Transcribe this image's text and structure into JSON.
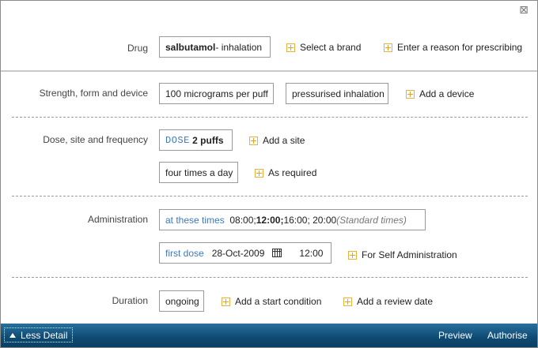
{
  "close_icon_glyph": "⊠",
  "drug": {
    "label": "Drug",
    "name": "salbutamol",
    "route": " - inhalation",
    "brand_action": "Select a brand",
    "reason_action": "Enter a reason for prescribing"
  },
  "strength": {
    "label": "Strength, form and device",
    "strength_value": "100 micrograms per puff",
    "form_value": "pressurised inhalation",
    "device_action": "Add a device"
  },
  "dose": {
    "label": "Dose, site and frequency",
    "dose_keyword": "DOSE",
    "dose_value": "2 puffs",
    "site_action": "Add a site",
    "frequency_value": "four times a day",
    "as_required_action": "As required"
  },
  "administration": {
    "label": "Administration",
    "times_keyword": "at these times",
    "time1": "08:00; ",
    "time2": "12:00;",
    "time3": " 16:00; 20:00 ",
    "times_note": "(Standard times)",
    "first_dose_keyword": "first dose",
    "first_dose_date": "28-Oct-2009",
    "first_dose_time": "12:00",
    "self_admin_action": "For Self Administration"
  },
  "duration": {
    "label": "Duration",
    "value": "ongoing",
    "start_action": "Add a start condition",
    "review_action": "Add a review date"
  },
  "footer": {
    "less_detail": "Less Detail",
    "preview": "Preview",
    "authorise": "Authorise"
  },
  "colors": {
    "accent_blue": "#3d78b8",
    "plus_orange": "#e8a21c",
    "footer_blue": "#0e4a73"
  }
}
